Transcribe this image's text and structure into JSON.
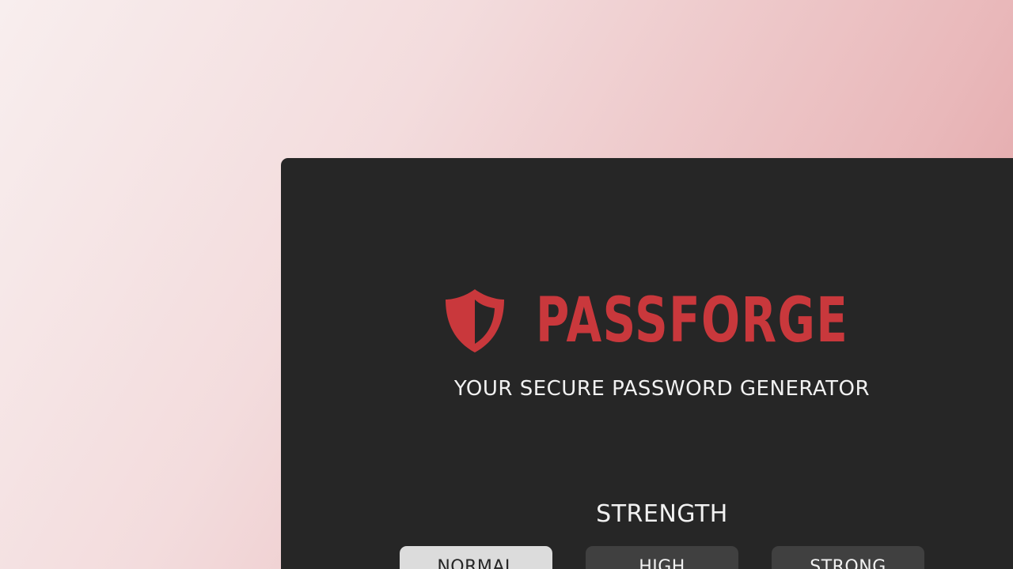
{
  "app": {
    "name": "PASSFORGE",
    "tagline": "YOUR SECURE PASSWORD GENERATOR",
    "logo_icon": "shield-icon",
    "accent_color": "#c9383c",
    "panel_color": "#262626"
  },
  "strength": {
    "title": "STRENGTH",
    "selected": "NORMAL",
    "options": [
      {
        "label": "NORMAL"
      },
      {
        "label": "HIGH"
      },
      {
        "label": "STRONG"
      }
    ]
  }
}
